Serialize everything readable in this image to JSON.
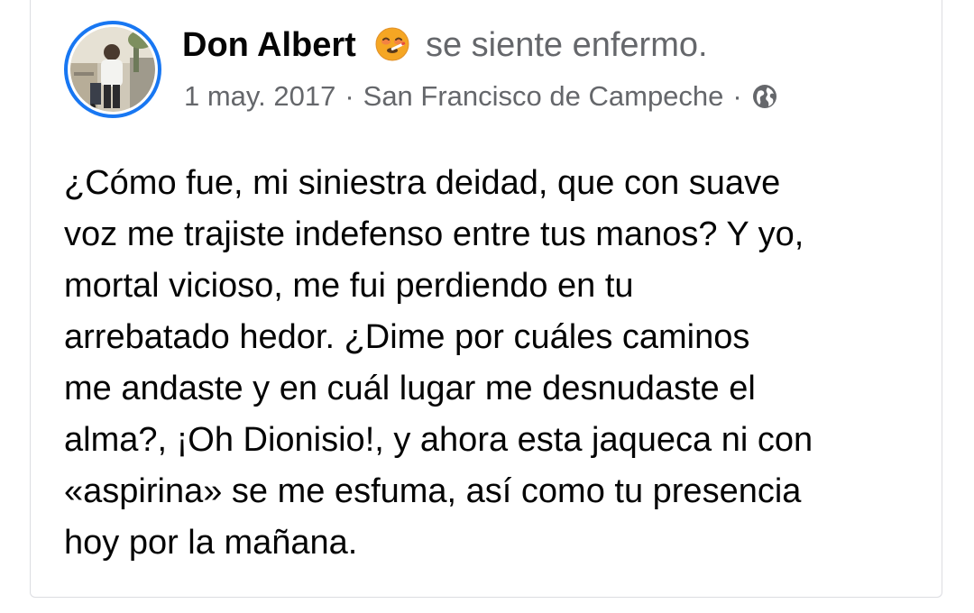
{
  "post": {
    "author": {
      "name": "Don Albert",
      "avatar": "avatar-photo"
    },
    "feeling": {
      "icon": "sick-face-emoji",
      "text": "se siente enfermo."
    },
    "meta": {
      "date": "1 may. 2017",
      "separator": "·",
      "location": "San Francisco de Campeche",
      "audience_icon": "globe-icon"
    },
    "body_lines": [
      "¿Cómo fue, mi siniestra deidad, que con suave",
      "voz me trajiste indefenso entre tus manos? Y yo,",
      "mortal vicioso, me fui perdiendo en tu",
      "arrebatado hedor. ¿Dime por cuáles caminos",
      "me andaste y en cuál lugar me desnudaste el",
      "alma?, ¡Oh Dionisio!, y ahora esta jaqueca ni con",
      "«aspirina» se me esfuma, así como tu presencia",
      "hoy por la mañana."
    ]
  },
  "colors": {
    "ring": "#1877f2",
    "primary_text": "#050505",
    "secondary_text": "#65676b",
    "border": "#dcdde1"
  }
}
